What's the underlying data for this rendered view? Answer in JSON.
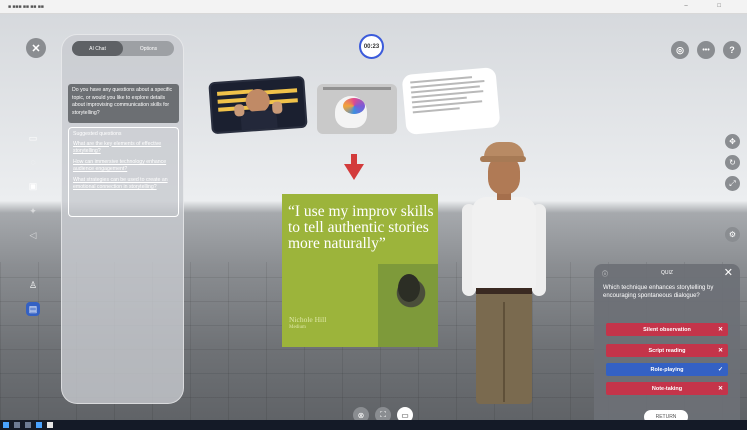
{
  "window": {
    "title": "■ ■■■ ■■ ■■ ■■",
    "controls": "– □"
  },
  "timer": "00:23",
  "panel": {
    "tabs": [
      "AI Chat",
      "Options"
    ],
    "question": "Do you have any questions about a specific topic, or would you like to explore details about improvising communication skills for storytelling?",
    "suggested_heading": "Suggested questions",
    "suggested_questions": [
      "What are the key elements of effective storytelling?",
      "How can immersive technology enhance audience engagement?",
      "What strategies can be used to create an emotional connection in storytelling?"
    ]
  },
  "quote_card": {
    "quote": "“I use my improv skills to tell authentic stories more naturally”",
    "name": "Nichole Hill",
    "role": "Medium"
  },
  "quiz": {
    "info_icon": "ⓘ",
    "title": "QUIZ",
    "close": "✕",
    "question": "Which technique enhances storytelling by encouraging spontaneous dialogue?",
    "options": [
      {
        "label": "Silent observation",
        "state": "wrong",
        "mark": "✕"
      },
      {
        "label": "Script reading",
        "state": "wrong",
        "mark": "✕"
      },
      {
        "label": "Role-playing",
        "state": "correct",
        "mark": "✓"
      },
      {
        "label": "Note-taking",
        "state": "wrong",
        "mark": "✕"
      }
    ],
    "return_label": "RETURN"
  },
  "buttons": {
    "close_label": "✕",
    "more_label": "•••",
    "help_label": "?",
    "headset_label": "◎"
  },
  "icons": {
    "left": [
      "screen-icon",
      "chat-icon",
      "bubble-icon",
      "share-icon",
      "volume-icon",
      "mic-icon",
      "caption-icon"
    ],
    "right": [
      "move-icon",
      "rotate-icon",
      "resize-icon",
      "settings-icon"
    ],
    "bottom": [
      "close-icon",
      "expand-icon",
      "camera-icon"
    ]
  },
  "colors": {
    "accent_blue": "#3461c4",
    "wrong_red": "#c4344a",
    "arrow_red": "#d33b3b",
    "quote_green": "#9cb43b"
  }
}
